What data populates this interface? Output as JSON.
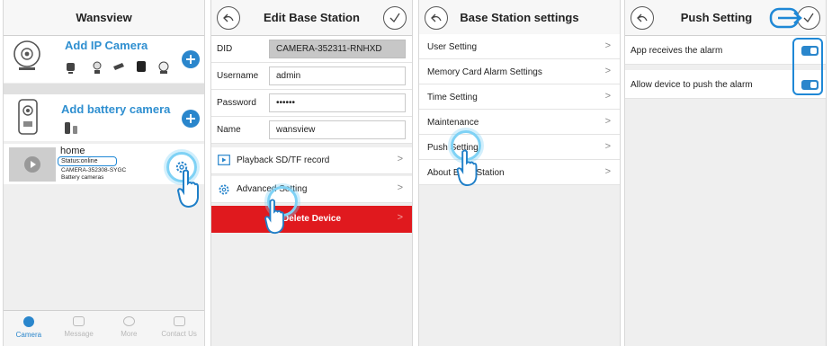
{
  "screen1": {
    "title": "Wansview",
    "add_ip_camera": "Add IP Camera",
    "add_battery_camera": "Add battery camera",
    "device": {
      "name": "home",
      "status": "Status:online",
      "id": "CAMERA-352308-SYGC",
      "type": "Battery cameras"
    },
    "tabs": [
      "Camera",
      "Message",
      "More",
      "Contact Us"
    ]
  },
  "screen2": {
    "title": "Edit Base Station",
    "did_label": "DID",
    "did_value": "CAMERA-352311-RNHXD",
    "username_label": "Username",
    "username_value": "admin",
    "password_label": "Password",
    "password_value": "••••••",
    "name_label": "Name",
    "name_value": "wansview",
    "playback": "Playback SD/TF record",
    "advanced": "Advanced Setting",
    "delete": "Delete Device"
  },
  "screen3": {
    "title": "Base Station settings",
    "items": [
      "User Setting",
      "Memory Card Alarm Settings",
      "Time Setting",
      "Maintenance",
      "Push Setting",
      "About Base Station"
    ]
  },
  "screen4": {
    "title": "Push Setting",
    "items": [
      {
        "label": "App receives the alarm",
        "on": true
      },
      {
        "label": "Allow device to push the alarm",
        "on": true
      }
    ]
  },
  "colors": {
    "accent": "#2a86cc",
    "danger": "#e0191e",
    "highlight": "#7fd2f5"
  }
}
